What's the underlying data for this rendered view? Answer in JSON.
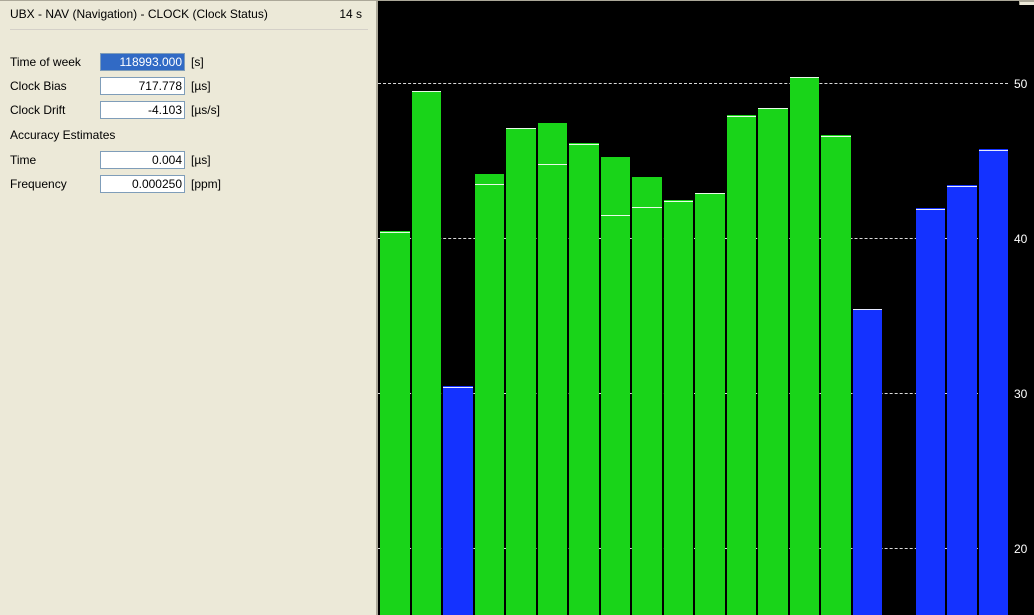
{
  "pane": {
    "title": "UBX - NAV (Navigation) - CLOCK (Clock Status)",
    "age": "14 s"
  },
  "fields": {
    "time_of_week": {
      "label": "Time of week",
      "value": "118993.000",
      "unit": "[s]"
    },
    "clock_bias": {
      "label": "Clock Bias",
      "value": "717.778",
      "unit": "[µs]"
    },
    "clock_drift": {
      "label": "Clock Drift",
      "value": "-4.103",
      "unit": "[µs/s]"
    },
    "accuracy_title": "Accuracy Estimates",
    "time_acc": {
      "label": "Time",
      "value": "0.004",
      "unit": "[µs]"
    },
    "freq_acc": {
      "label": "Frequency",
      "value": "0.000250",
      "unit": "[ppm]"
    }
  },
  "chart_data": {
    "type": "bar",
    "ylabel": "",
    "xlabel": "",
    "ylim_visible": [
      20,
      55
    ],
    "y_ticks": [
      20,
      30,
      40,
      50
    ],
    "bar_spacing": 2,
    "series_meta": {
      "green_primary": "signal strength (used)",
      "blue_primary": "signal strength (not used)",
      "black_top": "background to full height",
      "marker": "thin white separator near top of colored region"
    },
    "bars": [
      {
        "color": "green",
        "peak_black": 41,
        "value": 40.5,
        "marker": 40.4
      },
      {
        "color": "green",
        "peak_black": 50,
        "value": 49.6,
        "marker": 49.5
      },
      {
        "color": "blue",
        "peak_black": 41.5,
        "value": 30.5,
        "marker": 30.4
      },
      {
        "color": "green",
        "peak_black": 45,
        "value": 44.2,
        "marker": 43.5
      },
      {
        "color": "green",
        "peak_black": 48,
        "value": 47.2,
        "marker": 47.1
      },
      {
        "color": "green",
        "peak_black": 48,
        "value": 47.5,
        "marker": 44.8
      },
      {
        "color": "green",
        "peak_black": 47,
        "value": 46.2,
        "marker": 46.1
      },
      {
        "color": "green",
        "peak_black": 46,
        "value": 45.3,
        "marker": 41.5
      },
      {
        "color": "green",
        "peak_black": 48,
        "value": 44.0,
        "marker": 42.0
      },
      {
        "color": "green",
        "peak_black": 48,
        "value": 42.5,
        "marker": 42.4
      },
      {
        "color": "green",
        "peak_black": 44,
        "value": 43.0,
        "marker": 42.9
      },
      {
        "color": "green",
        "peak_black": 49,
        "value": 48.0,
        "marker": 47.9
      },
      {
        "color": "green",
        "peak_black": 49,
        "value": 48.5,
        "marker": 48.4
      },
      {
        "color": "green",
        "peak_black": 51,
        "value": 50.5,
        "marker": 50.4
      },
      {
        "color": "green",
        "peak_black": 47,
        "value": 46.7,
        "marker": 46.6
      },
      {
        "color": "blue",
        "peak_black": 47,
        "value": 35.5,
        "marker": 35.4
      },
      {
        "color": "none",
        "peak_black": 0,
        "value": 0,
        "marker": 0
      },
      {
        "color": "blue",
        "peak_black": 42,
        "value": 42.0,
        "marker": 41.9
      },
      {
        "color": "blue",
        "peak_black": 44,
        "value": 43.5,
        "marker": 43.4
      },
      {
        "color": "blue",
        "peak_black": 46,
        "value": 45.8,
        "marker": 45.7
      }
    ]
  },
  "colors": {
    "panel_bg": "#ece9d8",
    "chart_bg": "#000000",
    "green": "#19d419",
    "blue": "#1432ff",
    "grid": "#ffffff"
  }
}
